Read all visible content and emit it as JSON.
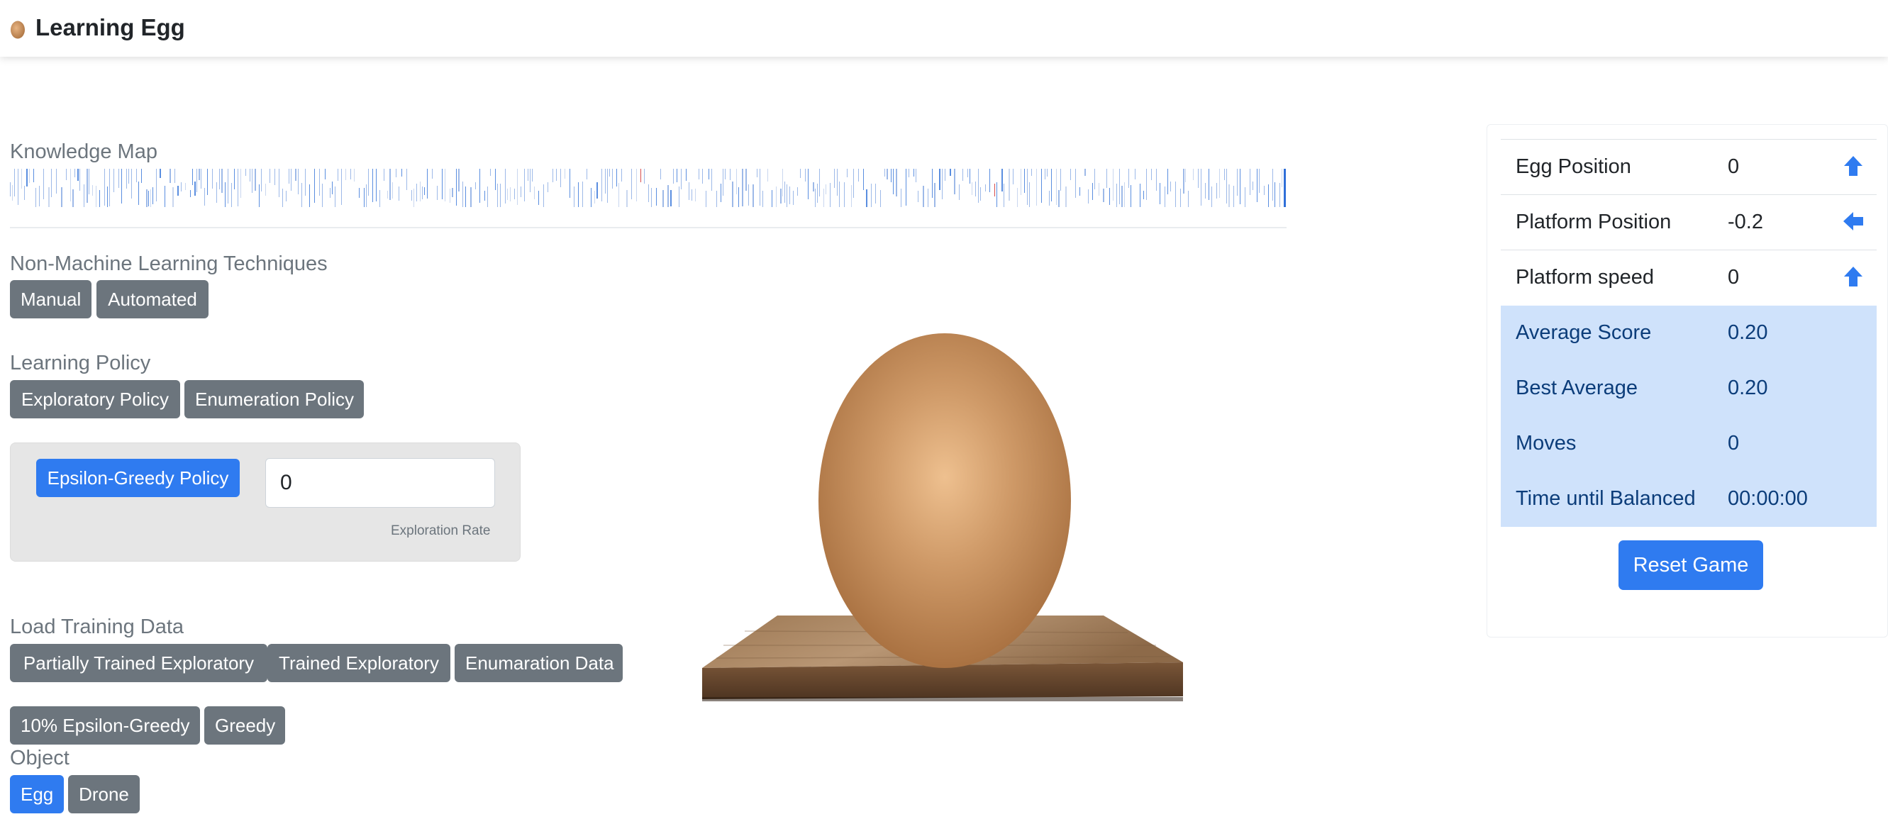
{
  "app": {
    "title": "Learning Egg",
    "brand_icon": "egg-icon"
  },
  "knowledge_map": {
    "label": "Knowledge Map"
  },
  "non_ml": {
    "label": "Non-Machine Learning Techniques",
    "buttons": [
      "Manual",
      "Automated"
    ]
  },
  "learning_policy": {
    "label": "Learning Policy",
    "buttons": [
      "Exploratory Policy",
      "Enumeration Policy"
    ]
  },
  "epsilon": {
    "button": "Epsilon-Greedy Policy",
    "value": "0",
    "help": "Exploration Rate"
  },
  "training": {
    "label": "Load Training Data",
    "buttons": [
      "Partially Trained Exploratory",
      "Trained Exploratory",
      "Enumaration Data",
      "10% Epsilon-Greedy",
      "Greedy"
    ]
  },
  "object": {
    "label": "Object",
    "buttons": [
      "Egg",
      "Drone"
    ],
    "selected": "Egg"
  },
  "stats": {
    "rows": [
      {
        "key": "Egg Position",
        "value": "0",
        "icon": "arrow-up-icon"
      },
      {
        "key": "Platform Position",
        "value": "-0.2",
        "icon": "arrow-left-icon"
      },
      {
        "key": "Platform speed",
        "value": "0",
        "icon": "arrow-up-icon"
      }
    ],
    "highlight_rows": [
      {
        "key": "Average Score",
        "value": "0.20"
      },
      {
        "key": "Best Average",
        "value": "0.20"
      },
      {
        "key": "Moves",
        "value": "0"
      },
      {
        "key": "Time until Balanced",
        "value": "00:00:00"
      }
    ],
    "reset": "Reset Game"
  },
  "colors": {
    "primary": "#2f7bf0",
    "secondary": "#6c757d",
    "highlight": "#cfe2fb",
    "egg": "#c48f5c",
    "wood": "#8a6442"
  }
}
